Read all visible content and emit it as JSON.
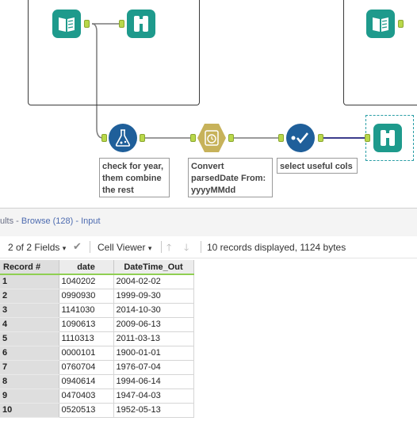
{
  "tools": {
    "check_annotation": "check for year,\nthem combine\nthe rest",
    "convert_annotation": "Convert\nparsedDate From:\nyyyyMMdd",
    "select_annotation": "select useful cols"
  },
  "results": {
    "title_prefix": "ults - ",
    "title_browse": "Browse (128) - Input"
  },
  "toolbar": {
    "fields_label": "2 of 2 Fields",
    "viewer_label": "Cell Viewer",
    "records_info": "10 records displayed, 1124 bytes"
  },
  "grid": {
    "columns": [
      "Record #",
      "date",
      "DateTime_Out"
    ],
    "rows": [
      {
        "rec": "1",
        "date": "1040202",
        "dt": "2004-02-02"
      },
      {
        "rec": "2",
        "date": "0990930",
        "dt": "1999-09-30"
      },
      {
        "rec": "3",
        "date": "1141030",
        "dt": "2014-10-30"
      },
      {
        "rec": "4",
        "date": "1090613",
        "dt": "2009-06-13"
      },
      {
        "rec": "5",
        "date": "1110313",
        "dt": "2011-03-13"
      },
      {
        "rec": "6",
        "date": "0000101",
        "dt": "1900-01-01"
      },
      {
        "rec": "7",
        "date": "0760704",
        "dt": "1976-07-04"
      },
      {
        "rec": "8",
        "date": "0940614",
        "dt": "1994-06-14"
      },
      {
        "rec": "9",
        "date": "0470403",
        "dt": "1947-04-03"
      },
      {
        "rec": "10",
        "date": "0520513",
        "dt": "1952-05-13"
      }
    ]
  },
  "colors": {
    "teal": "#1e9a8c",
    "blue": "#1f5f9a",
    "sand": "#c7b25a",
    "anchor": "#b9d84a",
    "header_underline": "#8fcf52"
  }
}
